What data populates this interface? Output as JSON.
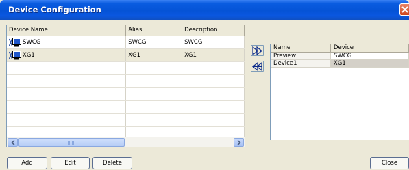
{
  "window": {
    "title": "Device Configuration"
  },
  "left_grid": {
    "columns": [
      "Device Name",
      "Alias",
      "Description"
    ],
    "rows": [
      {
        "name": "SWCG",
        "alias": "SWCG",
        "description": "SWCG"
      },
      {
        "name": "XG1",
        "alias": "XG1",
        "description": "XG1"
      }
    ]
  },
  "right_grid": {
    "columns": [
      "Name",
      "Device"
    ],
    "rows": [
      {
        "name": "Preview",
        "device": "SWCG"
      },
      {
        "name": "Device1",
        "device": "XG1"
      }
    ]
  },
  "buttons": {
    "add": "Add",
    "edit": "Edit",
    "delete": "Delete",
    "close": "Close"
  },
  "icons": {
    "close": "close-icon",
    "device": "monitor-with-x-icon",
    "move_right": "double-arrow-right-icon",
    "move_left": "double-arrow-left-icon"
  },
  "colors": {
    "titlebar": "#0553d6",
    "close_button": "#d0461c",
    "border": "#7f9db9"
  }
}
